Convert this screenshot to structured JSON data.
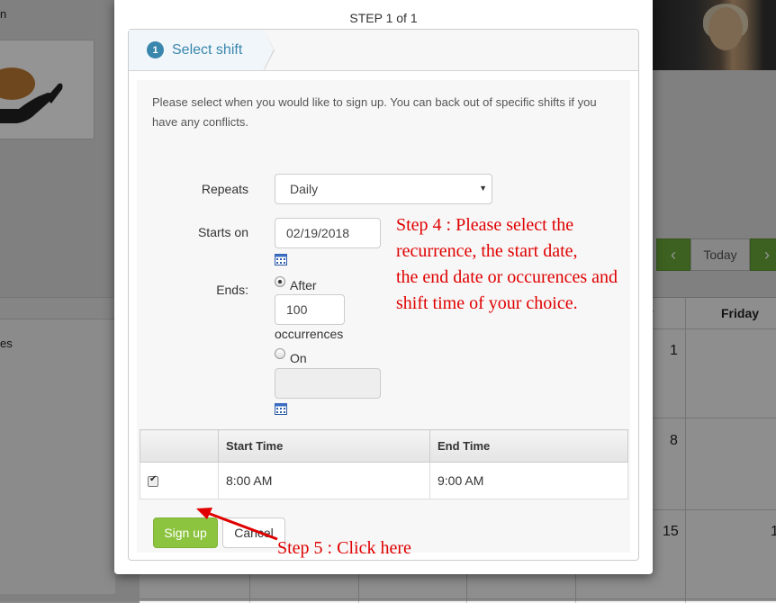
{
  "background": {
    "left_fragment_top": "n",
    "left_fragment_list": "es",
    "calendar_nav": {
      "today_label": "Today",
      "prev_icon": "chevron-left-icon",
      "next_icon": "chevron-right-icon"
    },
    "day_headers": [
      "y",
      "Friday"
    ],
    "day_numbers": [
      "1",
      "8",
      "15",
      "1"
    ]
  },
  "modal": {
    "step_title": "STEP 1 of 1",
    "tab": {
      "number": "1",
      "label": "Select shift"
    },
    "intro": "Please select when you would like to sign up. You can back out of specific shifts if you have any conflicts.",
    "repeats": {
      "label": "Repeats",
      "value": "Daily"
    },
    "starts_on": {
      "label": "Starts on",
      "value": "02/19/2018"
    },
    "ends": {
      "label": "Ends:",
      "after_label": "After",
      "after_value": "100",
      "occurrences_label": "occurrences",
      "on_label": "On",
      "on_value": ""
    },
    "table": {
      "headers": [
        "",
        "Start Time",
        "End Time"
      ],
      "rows": [
        {
          "checked": true,
          "start": "8:00 AM",
          "end": "9:00 AM"
        }
      ]
    },
    "buttons": {
      "signup": "Sign up",
      "cancel": "Cancel"
    }
  },
  "annotations": {
    "step4": [
      "Step 4 : Please select the",
      "recurrence, the start date,",
      "the end date or occurences and",
      "shift time of your choice."
    ],
    "step5": "Step 5 : Click here",
    "color": "#e00000"
  },
  "colors": {
    "accent": "#3a87ad",
    "signup": "#8cc43f",
    "calendar_nav": "#6aa83a"
  }
}
